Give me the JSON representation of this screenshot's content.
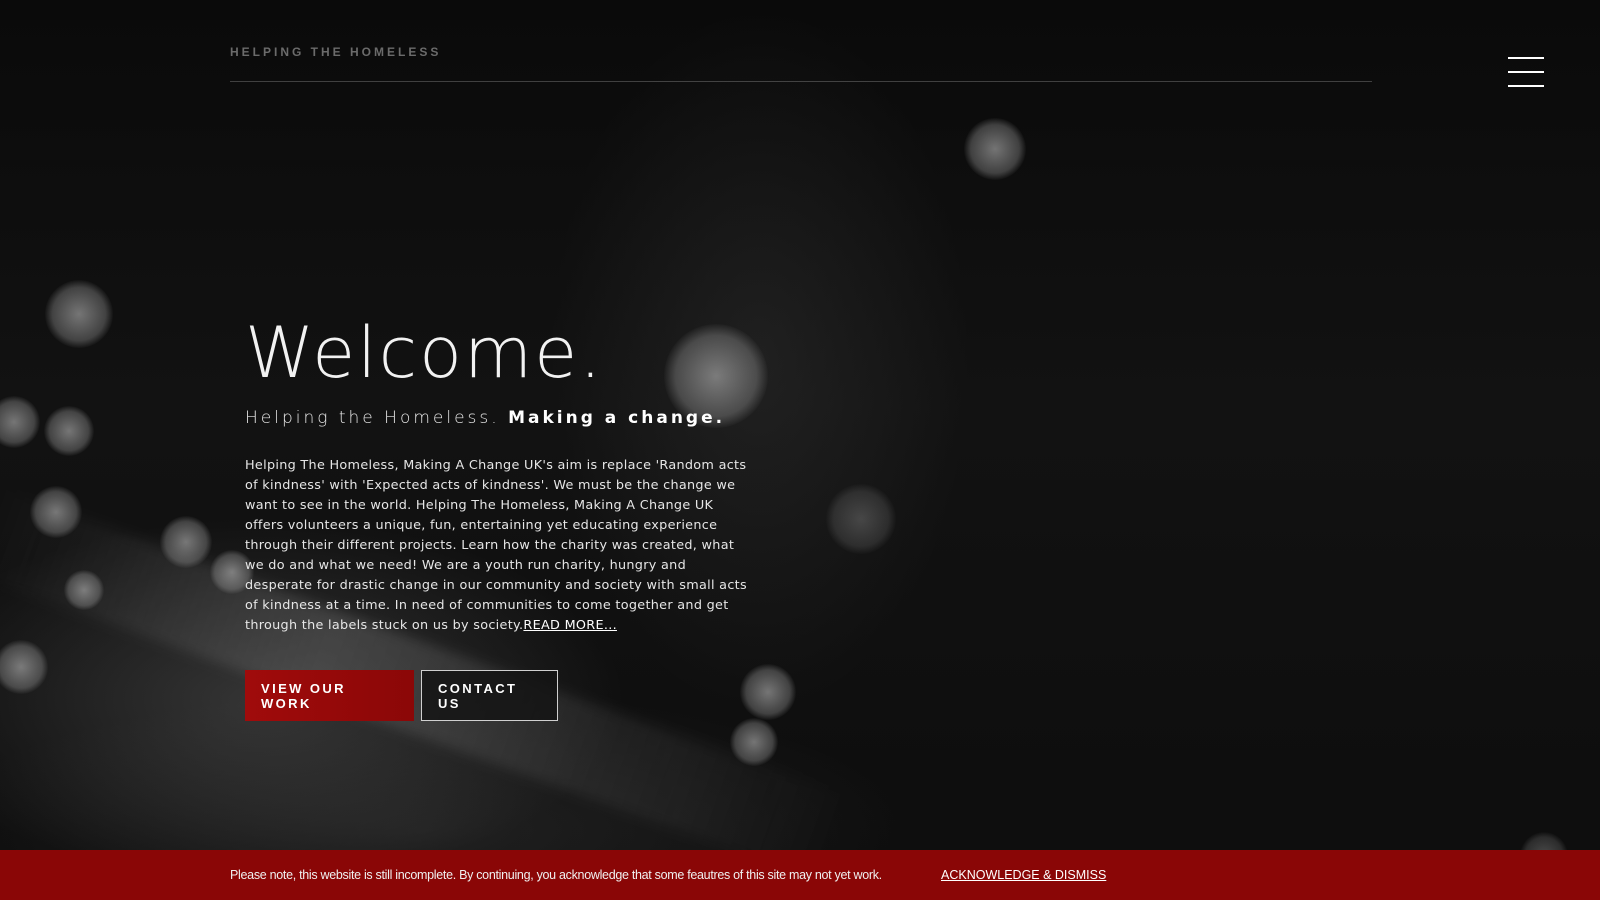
{
  "header": {
    "brand": "HELPING THE HOMELESS",
    "menu_icon": "hamburger-menu-icon"
  },
  "hero": {
    "title": "Welcome.",
    "subtitle_light": "Helping the Homeless.",
    "subtitle_bold": "Making a change.",
    "body": "Helping The Homeless, Making A Change UK's aim is replace 'Random acts of kindness' with 'Expected acts of kindness'. We must be the change we want to see in the world. Helping The Homeless, Making A Change UK offers volunteers a unique, fun, entertaining yet educating experience through their different projects. Learn how the charity was created, what we do and what we need! We are a youth run charity, hungry and desperate for drastic change in our community and society with small acts of kindness at a time. In need of communities to come together and get through the labels stuck on us by society.",
    "read_more": "READ MORE...",
    "primary_button": "VIEW OUR WORK",
    "secondary_button": "CONTACT US"
  },
  "notice": {
    "text": "Please note, this website is still incomplete. By continuing, you acknowledge that some feautres of this site may not yet work.",
    "dismiss": "ACKNOWLEDGE & DISMISS"
  },
  "colors": {
    "accent": "#9a0a0a",
    "notice_bar": "#8a0606",
    "background": "#0b0b0b"
  }
}
